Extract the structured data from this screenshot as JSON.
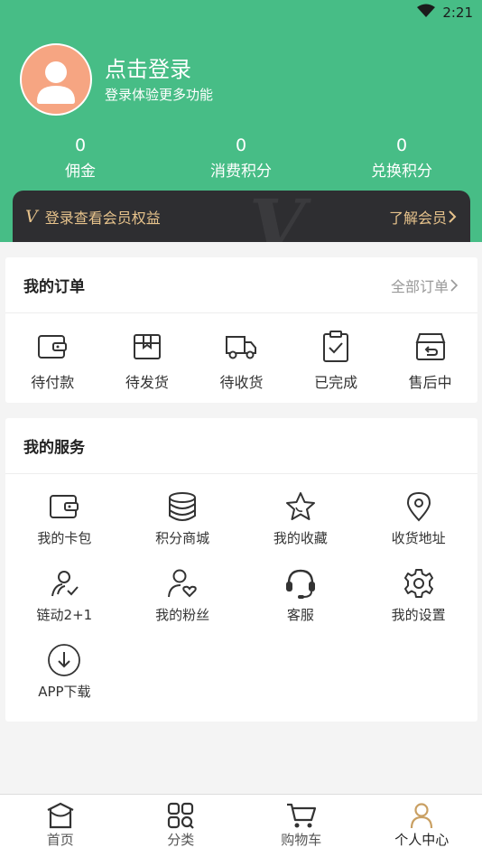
{
  "status_bar": {
    "time": "2:21"
  },
  "profile": {
    "login_title": "点击登录",
    "login_subtitle": "登录体验更多功能"
  },
  "stats": [
    {
      "value": "0",
      "label": "佣金"
    },
    {
      "value": "0",
      "label": "消费积分"
    },
    {
      "value": "0",
      "label": "兑换积分"
    }
  ],
  "vip": {
    "badge": "V",
    "text": "登录查看会员权益",
    "more": "了解会员"
  },
  "orders": {
    "title": "我的订单",
    "all_link": "全部订单",
    "items": [
      {
        "label": "待付款",
        "icon": "wallet-icon"
      },
      {
        "label": "待发货",
        "icon": "package-icon"
      },
      {
        "label": "待收货",
        "icon": "truck-icon"
      },
      {
        "label": "已完成",
        "icon": "clipboard-check-icon"
      },
      {
        "label": "售后中",
        "icon": "return-box-icon"
      }
    ]
  },
  "services": {
    "title": "我的服务",
    "items": [
      {
        "label": "我的卡包",
        "icon": "card-wallet-icon"
      },
      {
        "label": "积分商城",
        "icon": "coins-stack-icon"
      },
      {
        "label": "我的收藏",
        "icon": "star-icon"
      },
      {
        "label": "收货地址",
        "icon": "location-pin-icon"
      },
      {
        "label": "链动2+1",
        "icon": "users-link-icon"
      },
      {
        "label": "我的粉丝",
        "icon": "user-heart-icon"
      },
      {
        "label": "客服",
        "icon": "headset-icon"
      },
      {
        "label": "我的设置",
        "icon": "gear-icon"
      },
      {
        "label": "APP下载",
        "icon": "download-circle-icon"
      }
    ]
  },
  "bottom_nav": [
    {
      "label": "首页",
      "icon": "home-icon"
    },
    {
      "label": "分类",
      "icon": "grid-search-icon"
    },
    {
      "label": "购物车",
      "icon": "cart-icon"
    },
    {
      "label": "个人中心",
      "icon": "person-icon",
      "active": true
    }
  ],
  "colors": {
    "brand_green": "#47bd86",
    "vip_gold": "#e7c38c",
    "vip_dark": "#2e2e31",
    "avatar_bg": "#f6a582",
    "active_nav": "#c9a063"
  }
}
